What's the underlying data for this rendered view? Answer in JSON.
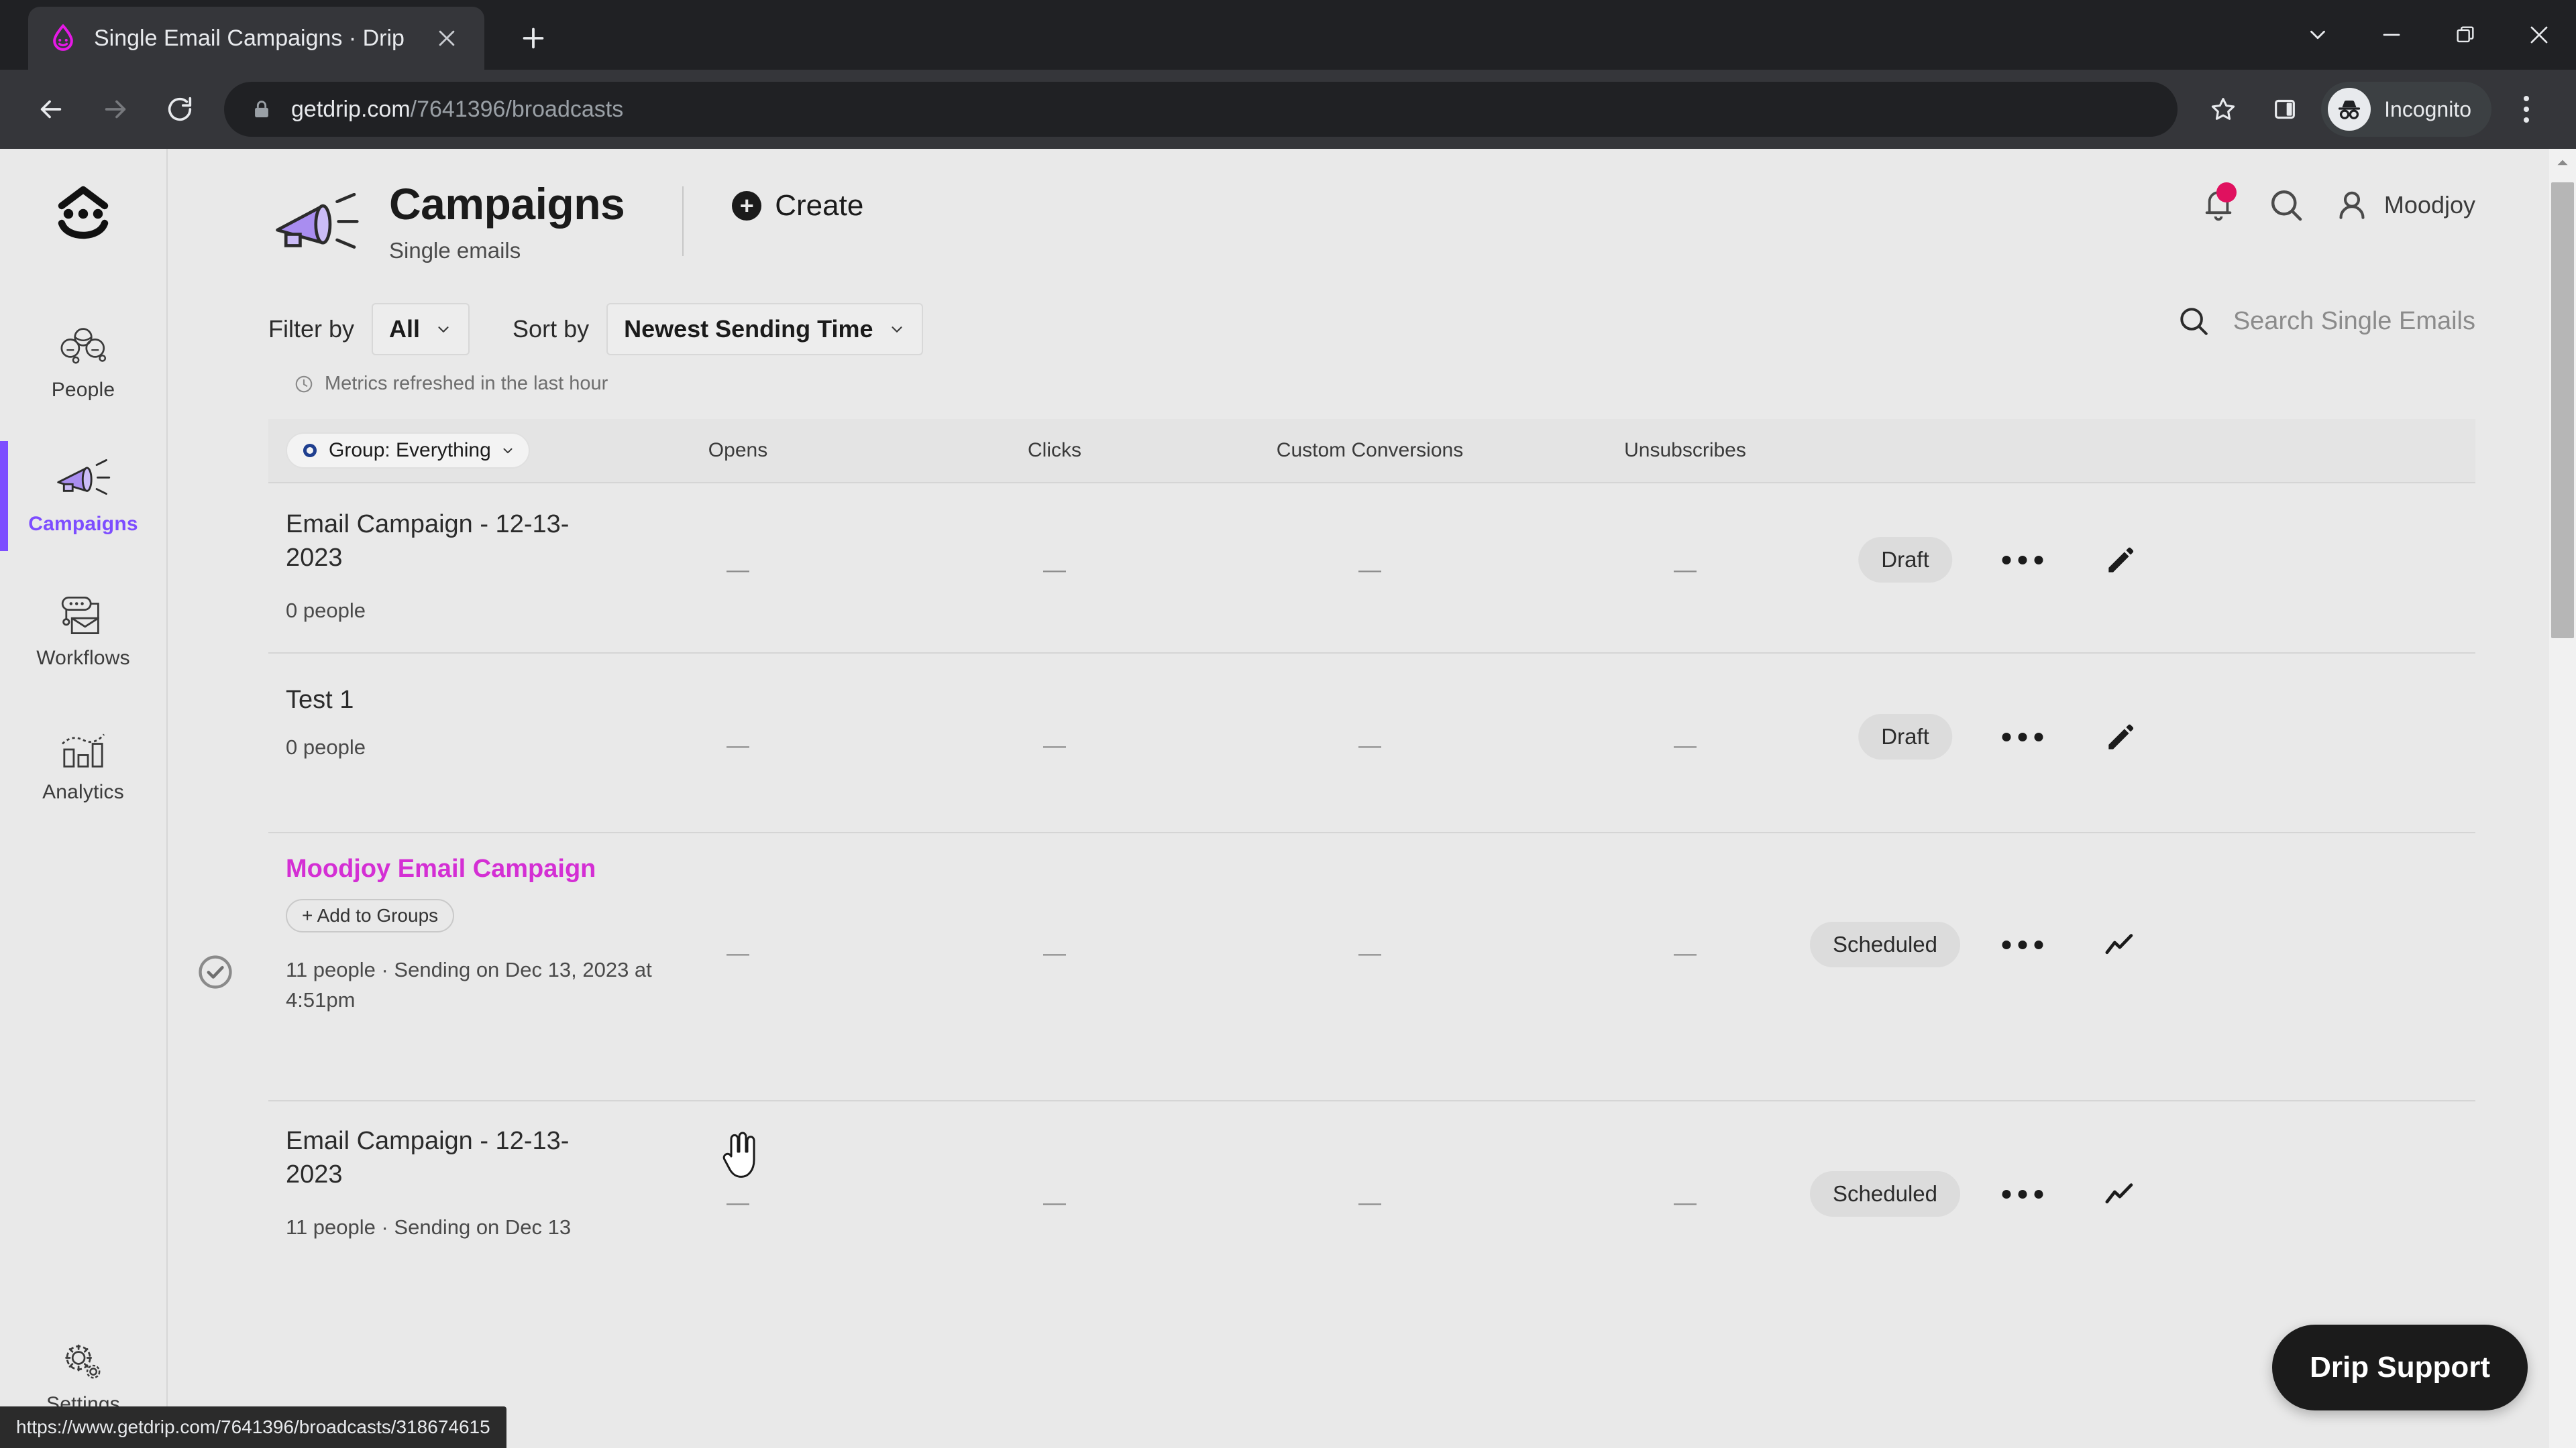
{
  "browser": {
    "tab": {
      "title": "Single Email Campaigns · Drip",
      "favicon_icon": "drip-favicon",
      "close_icon": "close-icon"
    },
    "new_tab_icon": "plus-icon",
    "window_controls": [
      {
        "name": "tab-search-button",
        "icon": "chevron-down-icon"
      },
      {
        "name": "minimize-button",
        "icon": "minimize-icon"
      },
      {
        "name": "maximize-button",
        "icon": "restore-icon"
      },
      {
        "name": "close-window-button",
        "icon": "close-icon"
      }
    ],
    "nav": {
      "back_icon": "arrow-left-icon",
      "forward_icon": "arrow-right-icon",
      "reload_icon": "reload-icon"
    },
    "omnibox": {
      "lock_icon": "lock-icon",
      "url_host": "getdrip.com",
      "url_path": "/7641396/broadcasts"
    },
    "star_icon": "bookmark-star-icon",
    "side_panel_icon": "side-panel-icon",
    "profile": {
      "label": "Incognito",
      "icon": "incognito-icon"
    },
    "menu_icon": "kebab-menu-icon",
    "status_url": "https://www.getdrip.com/7641396/broadcasts/318674615"
  },
  "sidebar": {
    "brand_icon": "drip-logo-icon",
    "items": [
      {
        "label": "People",
        "icon": "people-icon",
        "active": false
      },
      {
        "label": "Campaigns",
        "icon": "megaphone-icon",
        "active": true
      },
      {
        "label": "Workflows",
        "icon": "workflows-icon",
        "active": false
      },
      {
        "label": "Analytics",
        "icon": "analytics-icon",
        "active": false
      }
    ],
    "bottom": {
      "label": "Settings",
      "icon": "gear-icon"
    }
  },
  "header": {
    "icon": "megaphone-icon",
    "title": "Campaigns",
    "subtitle": "Single emails",
    "create_label": "Create",
    "create_icon": "plus-circle-icon",
    "notifications_icon": "bell-icon",
    "search_icon": "search-icon",
    "account_icon": "user-icon",
    "account_name": "Moodjoy"
  },
  "controls": {
    "filter_label": "Filter by",
    "filter_value": "All",
    "sort_label": "Sort by",
    "sort_value": "Newest Sending Time",
    "chevron_icon": "chevron-down-icon",
    "search_icon": "search-icon",
    "search_placeholder": "Search Single Emails",
    "metrics_note": "Metrics refreshed in the last hour",
    "clock_icon": "clock-icon"
  },
  "table": {
    "group_chip": {
      "label": "Group: Everything",
      "icon": "group-icon",
      "chevron_icon": "chevron-down-icon"
    },
    "columns": [
      "Opens",
      "Clicks",
      "Custom Conversions",
      "Unsubscribes"
    ],
    "rows": [
      {
        "name": "Email Campaign - 12-13-2023",
        "sub": "0 people",
        "chip": null,
        "metrics": [
          "—",
          "—",
          "—",
          "—"
        ],
        "status": "Draft",
        "more_icon": "more-horizontal-icon",
        "action_icon": "pencil-icon",
        "highlight": false,
        "selected": false
      },
      {
        "name": "Test 1",
        "sub": "0 people",
        "chip": null,
        "metrics": [
          "—",
          "—",
          "—",
          "—"
        ],
        "status": "Draft",
        "more_icon": "more-horizontal-icon",
        "action_icon": "pencil-icon",
        "highlight": false,
        "selected": false
      },
      {
        "name": "Moodjoy Email Campaign",
        "sub": "11 people · Sending on Dec 13, 2023 at 4:51pm",
        "chip": "+ Add to Groups",
        "metrics": [
          "—",
          "—",
          "—",
          "—"
        ],
        "status": "Scheduled",
        "more_icon": "more-horizontal-icon",
        "action_icon": "trend-line-icon",
        "highlight": true,
        "selected": true,
        "check_icon": "circle-check-icon"
      },
      {
        "name": "Email Campaign - 12-13-2023",
        "sub": "11 people · Sending on Dec 13",
        "chip": null,
        "metrics": [
          "—",
          "—",
          "—",
          "—"
        ],
        "status": "Scheduled",
        "more_icon": "more-horizontal-icon",
        "action_icon": "trend-line-icon",
        "highlight": false,
        "selected": false
      }
    ]
  },
  "support_button": {
    "label": "Drip Support"
  },
  "colors": {
    "accent_purple": "#7d4dff",
    "link_magenta": "#d42fd4",
    "notification_red": "#e0115f",
    "page_bg": "#e9e9e9",
    "chrome_bg": "#202124"
  }
}
